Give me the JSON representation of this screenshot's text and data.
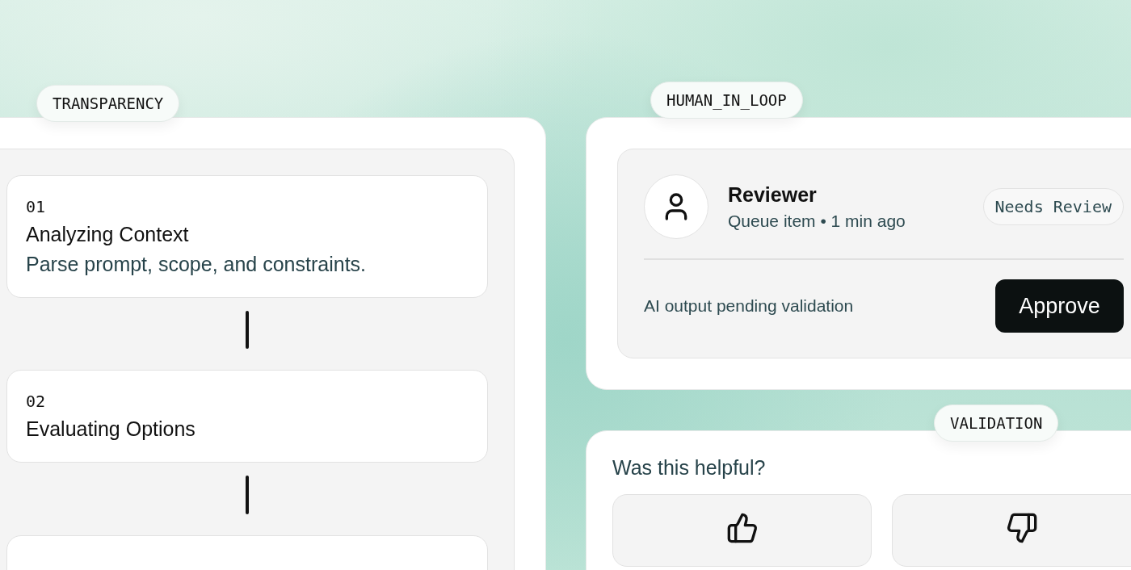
{
  "transparency": {
    "label": "TRANSPARENCY",
    "steps": [
      {
        "kind": "step",
        "number": "01",
        "title": "Analyzing Context",
        "description": "Parse prompt, scope, and constraints."
      },
      {
        "kind": "step",
        "number": "02",
        "title": "Evaluating Options"
      },
      {
        "kind": "step"
      }
    ]
  },
  "human_in_loop": {
    "label": "HUMAN_IN_LOOP",
    "reviewer": "Reviewer",
    "meta": "Queue item • 1 min ago",
    "status": "Needs Review",
    "message": "AI output pending validation",
    "action": "Approve"
  },
  "validation": {
    "label": "VALIDATION",
    "question": "Was this helpful?",
    "buttons": [
      {
        "kind": "thumbs-up"
      },
      {
        "kind": "thumbs-down"
      }
    ]
  }
}
